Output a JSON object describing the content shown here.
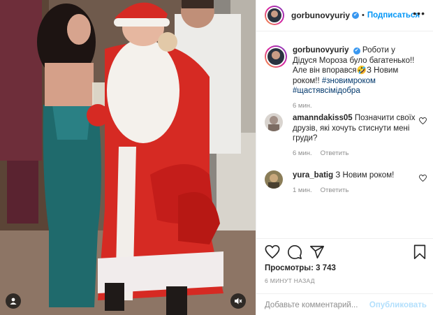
{
  "post": {
    "author": "gorbunovyuriy",
    "verified_mark": "✔",
    "dot": "•",
    "follow_label": "Подписаться",
    "more_label": "•••",
    "caption_text": "Роботи у Дідуся Мороза було багатенько!!Але він впорався🤣З Новим роком!!",
    "caption_tags": "#зновимроком #щастявсімідобра",
    "caption_time": "6 мин."
  },
  "comments": [
    {
      "username": "amanndakiss05",
      "text": "Позначити своїх друзів, які хочуть стиснути мені груди?",
      "time": "6 мин.",
      "reply": "Ответить"
    },
    {
      "username": "yura_batig",
      "text": "З Новим роком!",
      "time": "1 мин.",
      "reply": "Ответить"
    }
  ],
  "actions": {
    "views_label": "Просмотры:",
    "views_count": "3 743",
    "timestamp": "6 МИНУТ НАЗАД"
  },
  "composer": {
    "placeholder": "Добавьте комментарий...",
    "publish_label": "Опубликовать"
  },
  "icons": {
    "like": "heart-icon",
    "comment": "comment-icon",
    "share": "paper-plane-icon",
    "save": "bookmark-icon",
    "tag": "person-tag-icon",
    "mute": "speaker-muted-icon",
    "more": "more-options-icon"
  },
  "colors": {
    "accent": "#0095f6",
    "publish_disabled": "#b2dffc",
    "hashtag": "#00376b",
    "muted_text": "#8e8e8e"
  }
}
